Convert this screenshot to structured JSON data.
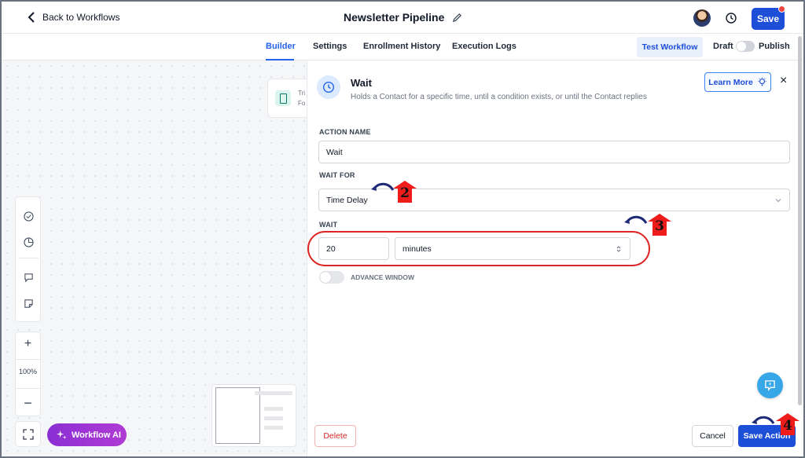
{
  "header": {
    "back_label": "Back to Workflows",
    "title": "Newsletter Pipeline",
    "save_label": "Save"
  },
  "tabs": [
    {
      "label": "Builder",
      "active": true
    },
    {
      "label": "Settings",
      "active": false
    },
    {
      "label": "Enrollment History",
      "active": false
    },
    {
      "label": "Execution Logs",
      "active": false
    }
  ],
  "tabbar_right": {
    "test_label": "Test Workflow",
    "draft_label": "Draft",
    "publish_label": "Publish",
    "published": false
  },
  "canvas": {
    "trigger_card": {
      "line1": "Tri",
      "line2": "Fo"
    },
    "zoom": "100%",
    "zoom_in": "+",
    "zoom_out": "−",
    "ai_button": "Workflow AI"
  },
  "panel": {
    "title": "Wait",
    "description": "Holds a Contact for a specific time, until a condition exists, or until the Contact replies",
    "learn_more": "Learn More",
    "close": "×",
    "action_name_label": "ACTION NAME",
    "action_name_value": "Wait",
    "wait_for_label": "WAIT FOR",
    "wait_for_value": "Time Delay",
    "wait_label": "WAIT",
    "wait_amount": "20",
    "wait_unit": "minutes",
    "advance_window_label": "ADVANCE WINDOW",
    "advance_window_on": false,
    "delete_label": "Delete",
    "cancel_label": "Cancel",
    "save_action_label": "Save Action"
  },
  "annotations": [
    "2",
    "3",
    "4"
  ],
  "colors": {
    "primary": "#1d4ed8",
    "accent_purple": "#8b2fd3",
    "highlight_red": "#dc2626",
    "marker_red": "#ef1c1c"
  },
  "icons": [
    "chevron-left-icon",
    "pencil-icon",
    "history-icon",
    "check-circle-icon",
    "pie-chart-icon",
    "comment-icon",
    "sticky-note-icon",
    "fit-screen-icon",
    "sparkle-icon",
    "clock-icon",
    "lightbulb-icon",
    "chat-icon"
  ]
}
